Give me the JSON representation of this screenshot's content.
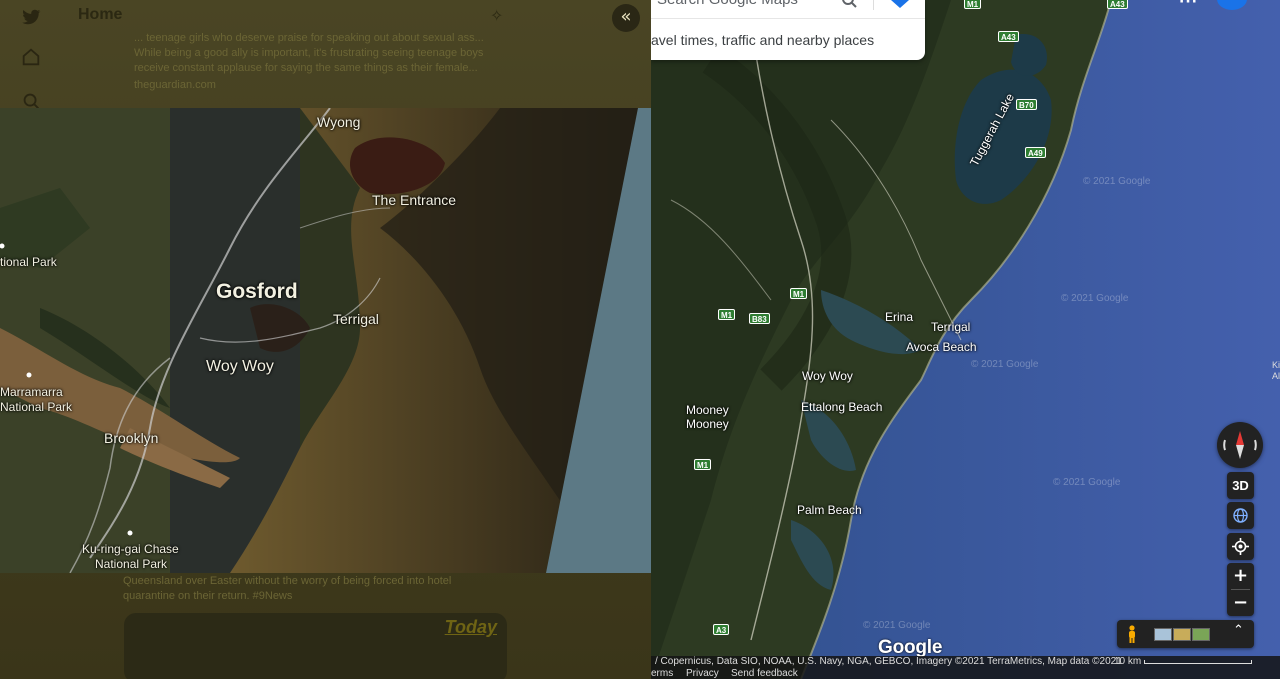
{
  "twitter": {
    "home_title": "Home",
    "tweet_lines": [
      "... teenage girls who deserve praise for speaking out about sexual ass...",
      "While being a good ally is important, it's frustrating seeing teenage boys",
      "receive constant applause for saying the same things as their female...",
      "theguardian.com"
    ],
    "bottom_lines": [
      "Queensland over Easter without the worry of being forced into hotel",
      "quarantine on their return. #9News"
    ],
    "today_label": "Today",
    "collapse_glyph": "«"
  },
  "overlay_map": {
    "labels": {
      "wyong": "Wyong",
      "the_entrance": "The Entrance",
      "gosford": "Gosford",
      "terrigal": "Terrigal",
      "woy_woy": "Woy Woy",
      "brooklyn": "Brooklyn",
      "national_park": "tional Park",
      "marramarra_1": "Marramarra",
      "marramarra_2": "National Park",
      "kuringgai_1": "Ku-ring-gai Chase",
      "kuringgai_2": "National Park"
    }
  },
  "google_map": {
    "search_value": "Search Google Maps",
    "search_hint": "avel times, traffic and nearby places",
    "labels": {
      "tuggerah_lake": "Tuggerah Lake",
      "erina": "Erina",
      "terrigal": "Terrigal",
      "avoca_beach": "Avoca Beach",
      "woy_woy": "Woy Woy",
      "ettalong_beach": "Ettalong Beach",
      "mooney_1": "Mooney",
      "mooney_2": "Mooney",
      "palm_beach": "Palm Beach"
    },
    "shields": {
      "m1_top": "M1",
      "a43_top": "A43",
      "a43": "A43",
      "b70": "B70",
      "a49": "A49",
      "m1_mid": "M1",
      "m1_left": "M1",
      "b83": "B83",
      "m1_low": "M1",
      "a3": "A3"
    },
    "watermark": "© 2021 Google",
    "controls": {
      "three_d": "3D",
      "zoom_in": "+",
      "zoom_out": "−",
      "expand": "⌃"
    },
    "logo": "Google",
    "attribution": "/ Copernicus, Data SIO, NOAA, U.S. Navy, NGA, GEBCO, Imagery ©2021 TerraMetrics, Map data ©2021",
    "scale": "10 km",
    "footer_links": [
      "erms",
      "Privacy",
      "Send feedback"
    ],
    "edge_text": "Ki\nAl"
  },
  "colors": {
    "ocean": "#3a5aa0",
    "overlay_tint": "#4a4524",
    "control_bg": "#222222",
    "search_bg": "#ffffff"
  }
}
